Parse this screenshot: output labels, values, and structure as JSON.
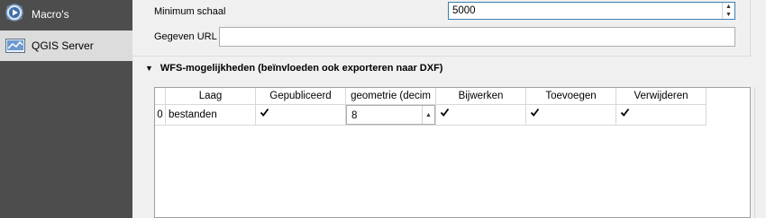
{
  "sidebar": {
    "items": [
      {
        "label": "Macro's",
        "icon": "macro-play-icon"
      },
      {
        "label": "QGIS Server",
        "icon": "qgis-server-icon",
        "selected": true
      }
    ]
  },
  "form": {
    "min_scale_label": "Minimum schaal",
    "min_scale_value": "5000",
    "data_url_label": "Gegeven URL",
    "data_url_value": ""
  },
  "wfs": {
    "title": "WFS-mogelijkheden (beïnvloeden ook exporteren naar DXF)",
    "columns": [
      "Laag",
      "Gepubliceerd",
      "geometrie (decim",
      "Bijwerken",
      "Toevoegen",
      "Verwijderen"
    ],
    "rows": [
      {
        "index": "0",
        "layer": "bestanden",
        "published": true,
        "precision": "8",
        "update": true,
        "insert": true,
        "delete": true
      }
    ]
  },
  "colors": {
    "sidebar_bg": "#4d4d4d",
    "sidebar_selected": "#dcdcdc",
    "focus_border": "#3c7fb1"
  }
}
